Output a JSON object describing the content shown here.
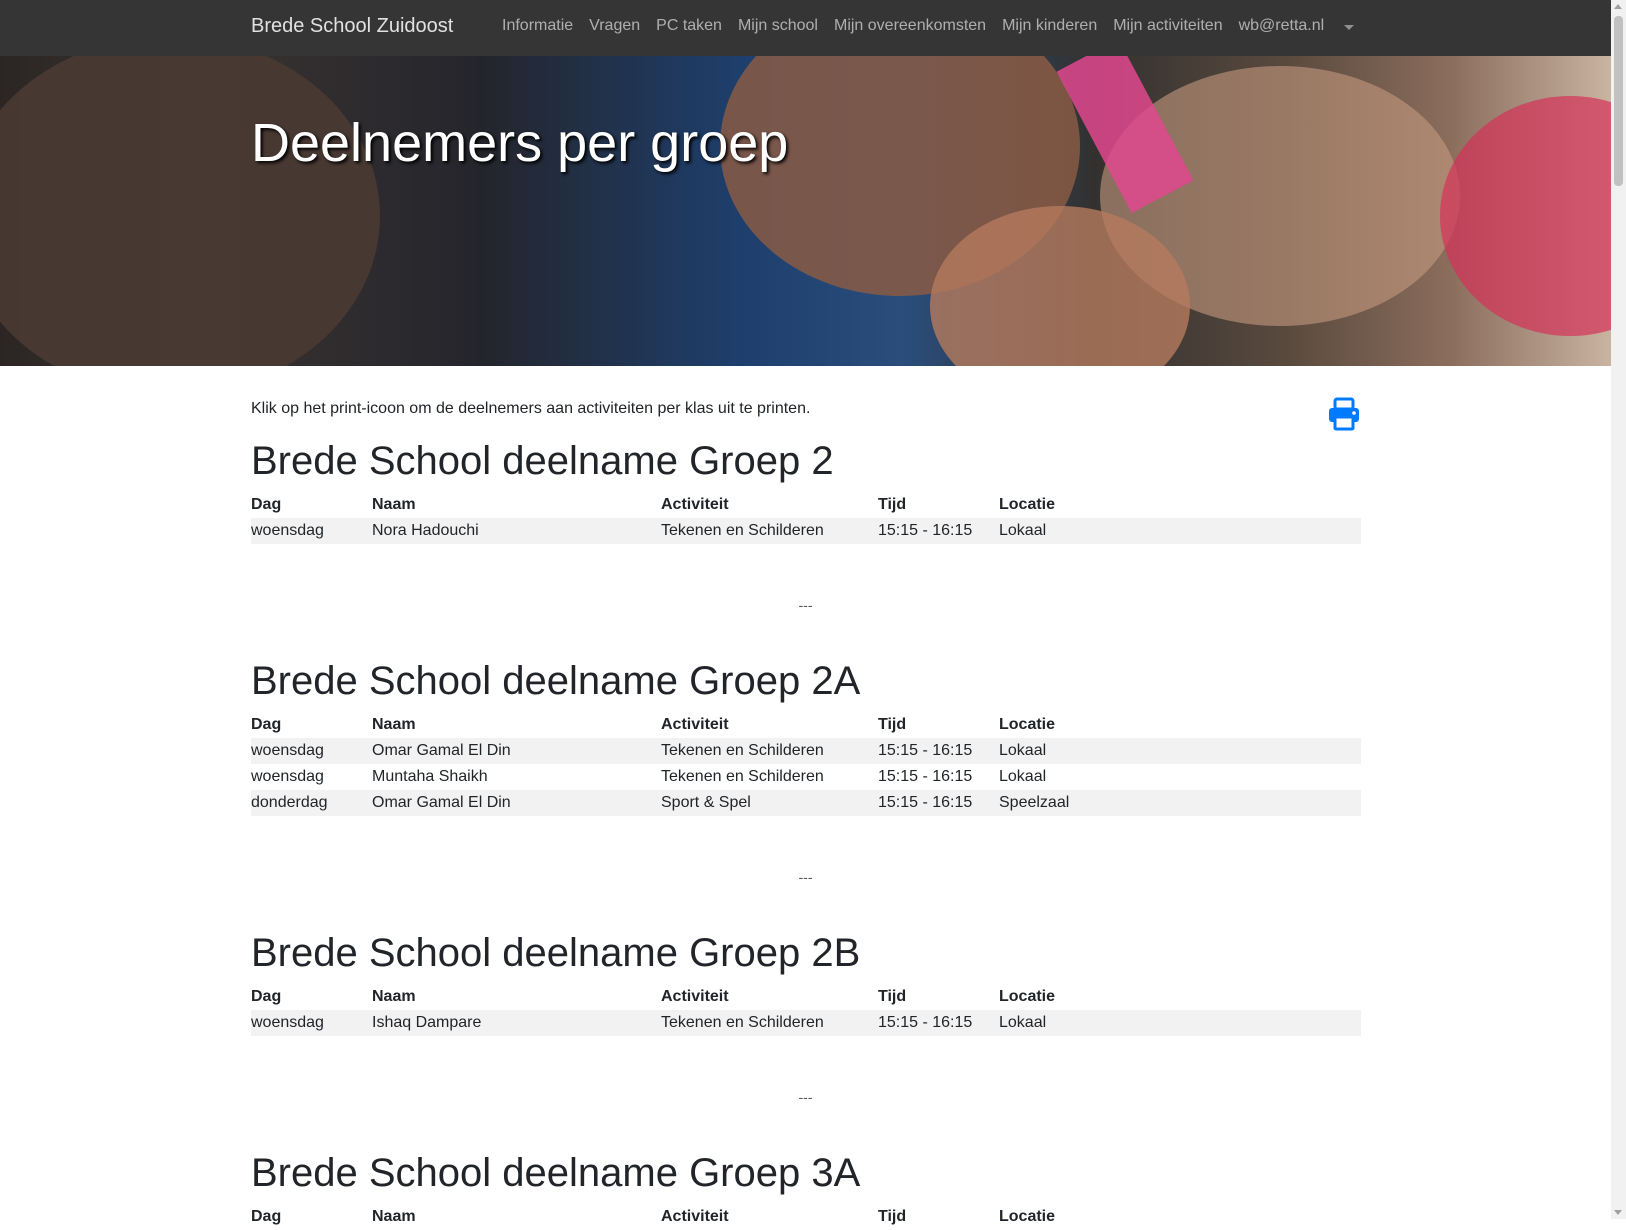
{
  "nav": {
    "brand": "Brede School Zuidoost",
    "links": [
      "Informatie",
      "Vragen",
      "PC taken",
      "Mijn school",
      "Mijn overeenkomsten",
      "Mijn kinderen",
      "Mijn activiteiten",
      "wb@retta.nl"
    ]
  },
  "hero": {
    "title": "Deelnemers per groep"
  },
  "intro": "Klik op het print-icoon om de deelnemers aan activiteiten per klas uit te printen.",
  "table_headers": [
    "Dag",
    "Naam",
    "Activiteit",
    "Tijd",
    "Locatie"
  ],
  "separator": "---",
  "groups": [
    {
      "title": "Brede School deelname Groep 2",
      "rows": [
        [
          "woensdag",
          "Nora Hadouchi",
          "Tekenen en Schilderen",
          "15:15 - 16:15",
          "Lokaal"
        ]
      ]
    },
    {
      "title": "Brede School deelname Groep 2A",
      "rows": [
        [
          "woensdag",
          "Omar Gamal El Din",
          "Tekenen en Schilderen",
          "15:15 - 16:15",
          "Lokaal"
        ],
        [
          "woensdag",
          "Muntaha Shaikh",
          "Tekenen en Schilderen",
          "15:15 - 16:15",
          "Lokaal"
        ],
        [
          "donderdag",
          "Omar Gamal El Din",
          "Sport & Spel",
          "15:15 - 16:15",
          "Speelzaal"
        ]
      ]
    },
    {
      "title": "Brede School deelname Groep 2B",
      "rows": [
        [
          "woensdag",
          "Ishaq Dampare",
          "Tekenen en Schilderen",
          "15:15 - 16:15",
          "Lokaal"
        ]
      ]
    },
    {
      "title": "Brede School deelname Groep 3A",
      "rows": []
    }
  ],
  "colors": {
    "navbar": "#353535",
    "print_icon": "#007bff",
    "row_stripe": "#f2f2f2"
  }
}
